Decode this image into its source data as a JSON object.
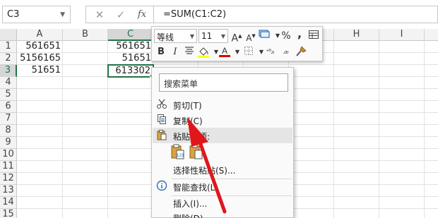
{
  "name_box": {
    "value": "C3"
  },
  "formula_bar": {
    "cancel_glyph": "✕",
    "enter_glyph": "✓",
    "fx_label": "fx",
    "formula": "=SUM(C1:C2)"
  },
  "columns": [
    "A",
    "B",
    "C",
    "D",
    "E",
    "F",
    "G",
    "H",
    "I"
  ],
  "selected_column": "C",
  "rows": [
    "1",
    "2",
    "3",
    "4",
    "5",
    "6",
    "7",
    "8",
    "9",
    "10",
    "11",
    "12",
    "13",
    "14",
    "15"
  ],
  "selected_row": "3",
  "cells": {
    "A1": "561651",
    "A2": "5156165",
    "A3": "51651",
    "C1": "561651",
    "C2": "51651",
    "C3": "613302"
  },
  "mini_toolbar": {
    "font_name": "等线",
    "font_size": "11",
    "grow_font": "A",
    "shrink_font": "A",
    "percent": "%",
    "comma": ",",
    "bold": "B",
    "italic": "I",
    "font_color_letter": "A",
    "increase_decimal": "⁺⁰.₀",
    "decrease_decimal": ".₀₀"
  },
  "context_menu": {
    "search_placeholder": "搜索菜单",
    "items": [
      {
        "label": "剪切(T)",
        "icon": "scissors-icon"
      },
      {
        "label": "复制(C)",
        "icon": "copy-icon"
      },
      {
        "label": "粘贴选项:",
        "icon": "paste-icon"
      },
      {
        "label": "选择性粘贴(S)...",
        "icon": ""
      },
      {
        "label": "智能查找(L)",
        "icon": "smart-lookup-icon"
      },
      {
        "label": "插入(I)...",
        "icon": ""
      },
      {
        "label": "删除(D)...",
        "icon": ""
      }
    ]
  },
  "colors": {
    "excel_green": "#217346",
    "arrow_red": "#e0161b",
    "font_color_bar": "#e00000",
    "highlight_bar": "#ffff00"
  }
}
